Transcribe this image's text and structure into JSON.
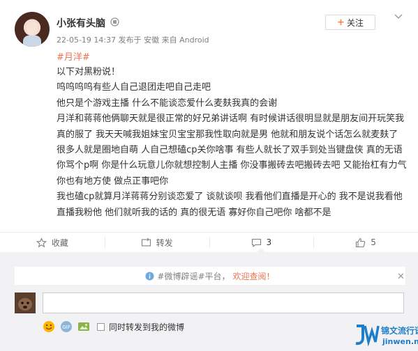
{
  "post": {
    "username": "小张有头脑",
    "meta": "22-05-19 14:37 发布于 安徽 来自 Android",
    "follow_label": "关注",
    "topic": "#月洋#",
    "paragraphs": [
      "以下对黑粉说！",
      "呜呜呜呜有些人自己退团走吧自己走吧",
      "他只是个游戏主播 什么不能谈恋爱什么麦麸我真的会谢",
      "月洋和蒋蒋他俩聊天就是很正常的好兄弟讲话啊 有时候讲话很明显就是朋友间开玩笑我真的服了 我天天喊我姐妹宝贝宝宝那我性取向就是男 他就和朋友说个话怎么就麦麸了 很多人就是圈地自萌 人自己想磕cp关你啥事 有些人就长了双手到处当键盘侠 真的无语 你骂个p啊 你是什么玩意儿你就想控制人主播 你没事搬砖去吧搬砖去吧 又能抬杠有力气你也有地方使 做点正事吧你",
      "我也磕cp就算月洋蒋蒋分别谈恋爱了 谈就谈呗 我看他们直播是开心的 我不是说我看他直播我粉他 他们就听我的话的 真的很无语 寡好你自己吧你 啥都不是"
    ]
  },
  "actions": {
    "favorite_label": "收藏",
    "repost_label": "转发",
    "comment_count": "3",
    "like_count": "5"
  },
  "comments": {
    "notice_prefix": "#微博辟谣#平台，",
    "notice_link": "欢迎查阅！",
    "input_placeholder": "",
    "repost_checkbox_label": "同时转发到我的微博"
  },
  "watermark": {
    "line1": "锦文流行语",
    "line2": "jinwen.net"
  },
  "colors": {
    "topic": "#eb7350",
    "comment_bg": "#f2f2f5",
    "like_icon": "#666666"
  }
}
